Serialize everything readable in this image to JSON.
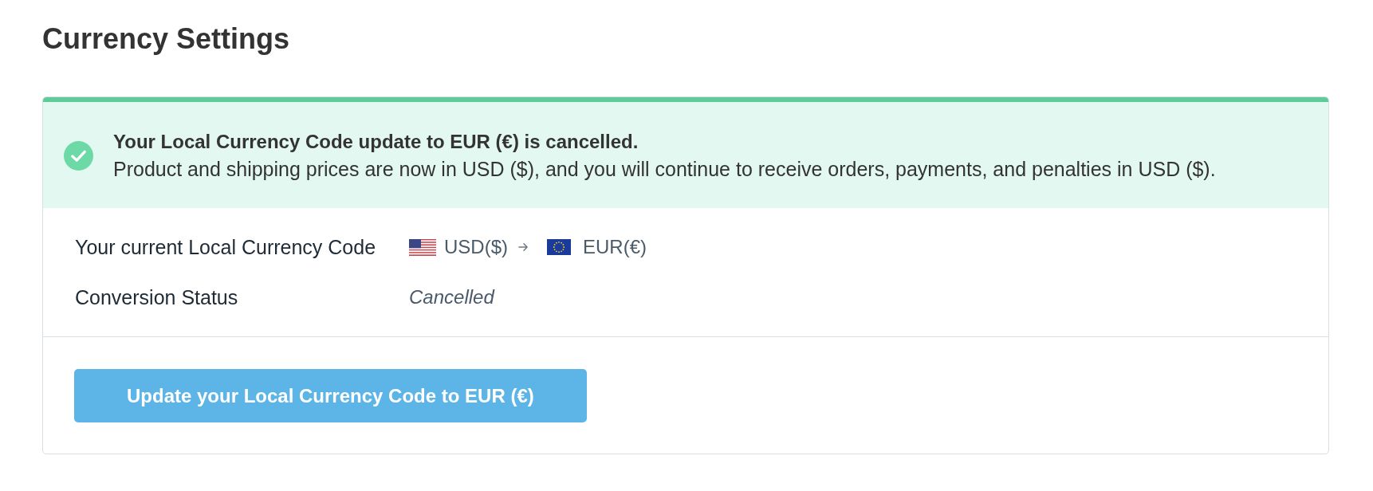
{
  "page": {
    "title": "Currency Settings"
  },
  "alert": {
    "kind": "success",
    "title": "Your Local Currency Code update to EUR (€) is cancelled.",
    "message": "Product and shipping prices are now in USD ($), and you will continue to receive orders, payments, and penalties in USD ($)."
  },
  "details": [
    {
      "kind": "currency_change",
      "label": "Your current Local Currency Code",
      "from": "USD($)",
      "to": "EUR(€)"
    },
    {
      "kind": "status",
      "label": "Conversion Status",
      "value": "Cancelled"
    }
  ],
  "button": {
    "label": "Update your Local Currency Code to EUR (€)"
  }
}
